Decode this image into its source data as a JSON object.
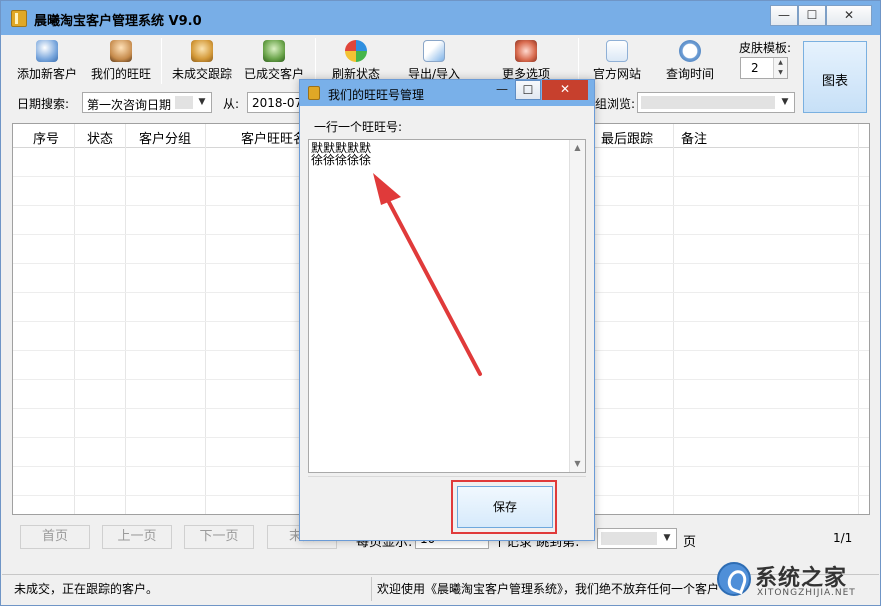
{
  "window": {
    "title": "晨曦淘宝客户管理系统 V9.0",
    "min_glyph": "—",
    "max_glyph": "☐",
    "close_glyph": "✕"
  },
  "toolbar": {
    "add_customer": "添加新客户",
    "our_wangwang": "我们的旺旺",
    "not_closed_followup": "未成交跟踪",
    "closed_customers": "已成交客户",
    "refresh_status": "刷新状态",
    "export_import": "导出/导入",
    "more_options": "更多选项",
    "official_site": "官方网站",
    "query_time": "查询时间",
    "skin_label": "皮肤模板:",
    "skin_value": "2",
    "chart_label": "图表"
  },
  "search": {
    "date_search_label": "日期搜索:",
    "date_field_value": "第一次咨询日期",
    "from_label": "从:",
    "from_value": "2018-07-",
    "browse_label": "组浏览:"
  },
  "grid": {
    "columns": [
      "序号",
      "状态",
      "客户分组",
      "客户旺旺名",
      "最后跟踪",
      "备注"
    ]
  },
  "pager": {
    "first": "首页",
    "prev": "上一页",
    "next": "下一页",
    "last": "末页",
    "per_page_label": "每页显示:",
    "per_page_value": "10",
    "records_label": "个记录  跳到第:",
    "page_suffix": "页",
    "page_count": "1/1"
  },
  "status_bar": {
    "left": "未成交，正在跟踪的客户。",
    "right": "欢迎使用《晨曦淘宝客户管理系统》，我们绝不放弃任何一个客户"
  },
  "watermark": {
    "text": "系统之家",
    "sub": "XITONGZHIJIA.NET"
  },
  "dialog": {
    "title": "我们的旺旺号管理",
    "instruction": "一行一个旺旺号:",
    "lines": "默默默默默\n徐徐徐徐徐",
    "save_label": "保存",
    "close_glyph": "✕",
    "max_glyph": "☐",
    "min_glyph": "—"
  },
  "colors": {
    "title_bar": "#78aee7",
    "dialog_close": "#c7402d",
    "annotation_red": "#e03a3a"
  }
}
